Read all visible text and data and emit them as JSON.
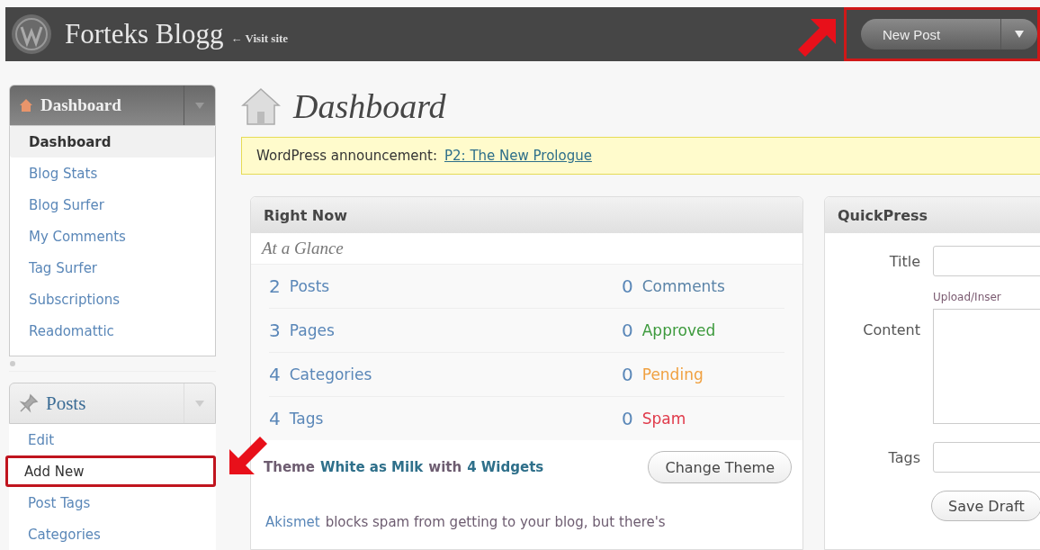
{
  "header": {
    "site_title": "Forteks Blogg",
    "visit_link": "← Visit site",
    "new_post_button": {
      "label": "New Post",
      "highlighted": true
    }
  },
  "sidebar": {
    "groups": [
      {
        "kind": "dashboard",
        "title": "Dashboard",
        "current": true,
        "items": [
          {
            "label": "Dashboard",
            "selected": true,
            "highlighted": false
          },
          {
            "label": "Blog Stats",
            "selected": false,
            "highlighted": false
          },
          {
            "label": "Blog Surfer",
            "selected": false,
            "highlighted": false
          },
          {
            "label": "My Comments",
            "selected": false,
            "highlighted": false
          },
          {
            "label": "Tag Surfer",
            "selected": false,
            "highlighted": false
          },
          {
            "label": "Subscriptions",
            "selected": false,
            "highlighted": false
          },
          {
            "label": "Readomattic",
            "selected": false,
            "highlighted": false
          }
        ]
      },
      {
        "kind": "posts",
        "title": "Posts",
        "current": false,
        "items": [
          {
            "label": "Edit",
            "selected": false,
            "highlighted": false
          },
          {
            "label": "Add New",
            "selected": false,
            "highlighted": true
          },
          {
            "label": "Post Tags",
            "selected": false,
            "highlighted": false
          },
          {
            "label": "Categories",
            "selected": false,
            "highlighted": false
          }
        ]
      }
    ]
  },
  "page_title": "Dashboard",
  "announcement": {
    "label": "WordPress announcement:",
    "link": "P2: The New Prologue"
  },
  "right_now": {
    "title": "Right Now",
    "subtitle": "At a Glance",
    "content": [
      {
        "count": "2",
        "label": "Posts"
      },
      {
        "count": "3",
        "label": "Pages"
      },
      {
        "count": "4",
        "label": "Categories"
      },
      {
        "count": "4",
        "label": "Tags"
      }
    ],
    "discussion": [
      {
        "count": "0",
        "label": "Comments",
        "color": "#5b84a8"
      },
      {
        "count": "0",
        "label": "Approved",
        "color": "#3d9a3d"
      },
      {
        "count": "0",
        "label": "Pending",
        "color": "#f0a040"
      },
      {
        "count": "0",
        "label": "Spam",
        "color": "#e03a4a"
      }
    ],
    "theme": {
      "prefix": "Theme",
      "name": "White as Milk",
      "middle": "with",
      "widgets": "4 Widgets"
    },
    "change_theme_button": "Change Theme",
    "akismet": {
      "link": "Akismet",
      "text": "blocks spam from getting to your blog, but there's"
    }
  },
  "quickpress": {
    "title": "QuickPress",
    "fields": [
      {
        "kind": "input",
        "label": "Title"
      },
      {
        "kind": "textarea",
        "label": "Content",
        "toolbar": "Upload/Inser"
      },
      {
        "kind": "input",
        "label": "Tags"
      }
    ],
    "save_draft_button": "Save Draft"
  }
}
